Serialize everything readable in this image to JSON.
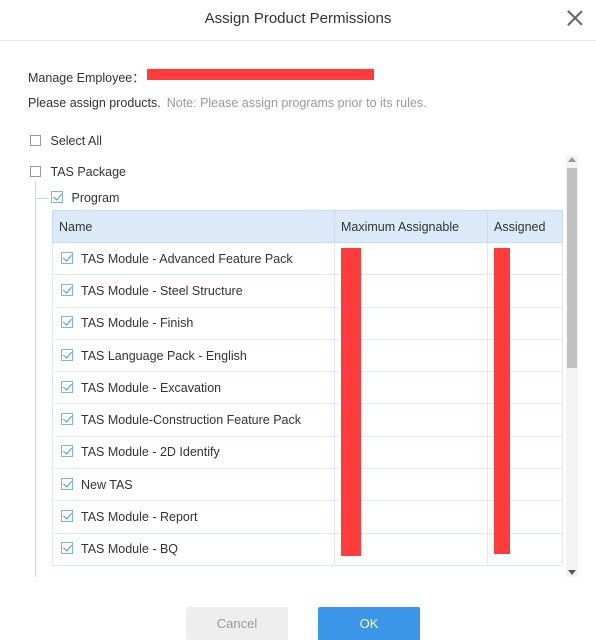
{
  "dialog": {
    "title": "Assign Product Permissions"
  },
  "employee": {
    "label": "Manage Employee："
  },
  "instructions": {
    "text": "Please assign products.",
    "note": "Note: Please assign programs prior to its rules."
  },
  "tree": {
    "select_all": "Select All",
    "package": "TAS Package",
    "program": "Program"
  },
  "table": {
    "headers": {
      "name": "Name",
      "max": "Maximum Assignable",
      "assigned": "Assigned"
    },
    "rows": [
      {
        "name": "TAS Module - Advanced Feature Pack"
      },
      {
        "name": "TAS Module - Steel Structure"
      },
      {
        "name": "TAS Module - Finish"
      },
      {
        "name": "TAS Language Pack - English"
      },
      {
        "name": "TAS Module - Excavation"
      },
      {
        "name": "TAS Module-Construction Feature Pack"
      },
      {
        "name": "TAS Module - 2D Identify"
      },
      {
        "name": "New TAS"
      },
      {
        "name": "TAS Module - Report"
      },
      {
        "name": "TAS Module - BQ"
      }
    ]
  },
  "buttons": {
    "cancel": "Cancel",
    "ok": "OK"
  },
  "colors": {
    "accent": "#3b95e8",
    "header_bg": "#dbe9f8",
    "redaction": "#ff3b3b"
  }
}
